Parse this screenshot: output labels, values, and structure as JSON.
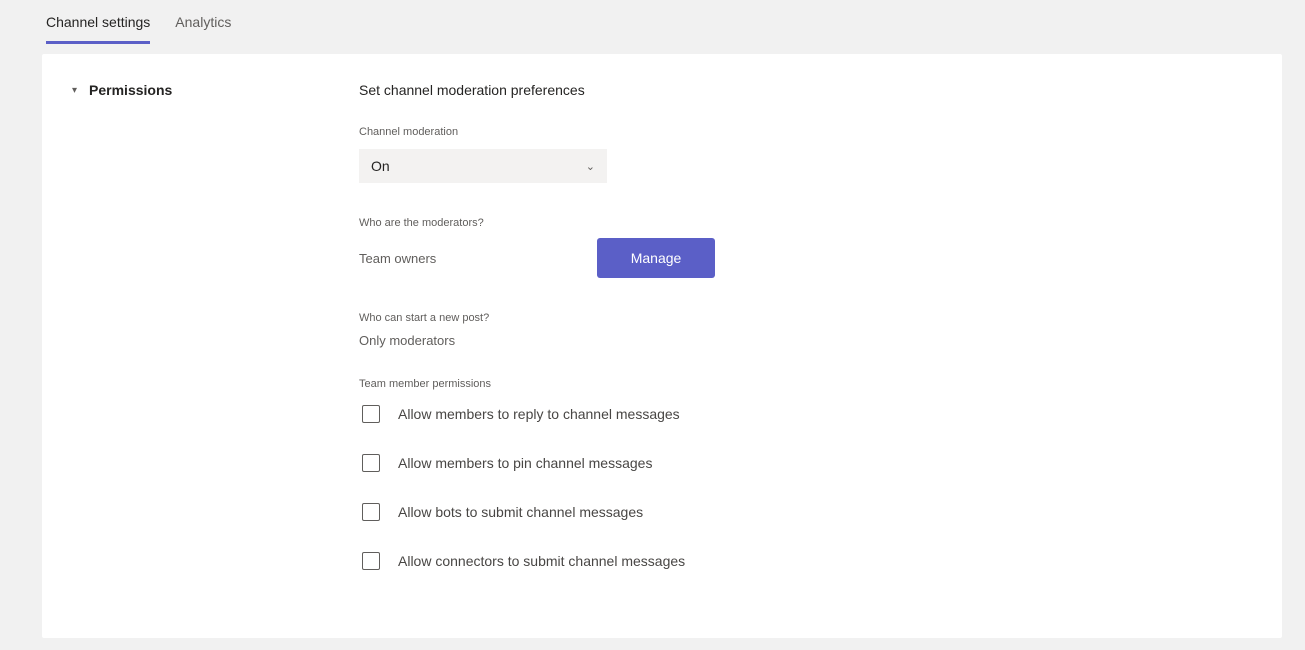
{
  "tabs": [
    {
      "label": "Channel settings",
      "active": true
    },
    {
      "label": "Analytics",
      "active": false
    }
  ],
  "section": {
    "caret": "▾",
    "title": "Permissions"
  },
  "moderation": {
    "title": "Set channel moderation preferences",
    "channel_moderation_label": "Channel moderation",
    "channel_moderation_value": "On",
    "chevron": "⌄",
    "moderators_label": "Who are the moderators?",
    "moderators_value": "Team owners",
    "manage_label": "Manage",
    "new_post_label": "Who can start a new post?",
    "new_post_value": "Only moderators",
    "member_permissions_label": "Team member permissions",
    "permissions": [
      {
        "label": "Allow members to reply to channel messages",
        "checked": false
      },
      {
        "label": "Allow members to pin channel messages",
        "checked": false
      },
      {
        "label": "Allow bots to submit channel messages",
        "checked": false
      },
      {
        "label": "Allow connectors to submit channel messages",
        "checked": false
      }
    ]
  },
  "colors": {
    "accent": "#5b5fc7",
    "page_bg": "#f1f1f1",
    "panel_bg": "#ffffff"
  }
}
